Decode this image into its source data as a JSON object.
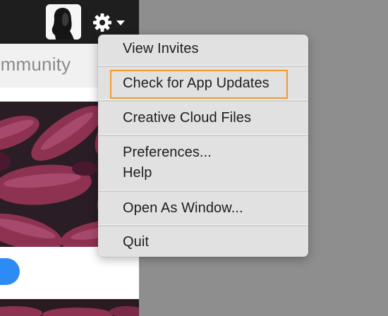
{
  "header": {
    "avatar_icon": "user-profile-silhouette",
    "settings_icon": "gear-icon",
    "dropdown_icon": "chevron-down-icon"
  },
  "community_tab": {
    "label": "ommunity"
  },
  "menu": {
    "items": [
      {
        "label": "View Invites"
      },
      {
        "label": "Check for App Updates"
      },
      {
        "label": "Creative Cloud Files"
      },
      {
        "label": "Preferences..."
      },
      {
        "label": "Help"
      },
      {
        "label": "Open As Window..."
      },
      {
        "label": "Quit"
      }
    ],
    "highlighted_item_color": "#f29a2e"
  },
  "colors": {
    "topbar": "#1e1e1e",
    "menu_bg": "#e2e1e2",
    "accent_button": "#2c8cf4",
    "backdrop": "#8e8e8e"
  }
}
